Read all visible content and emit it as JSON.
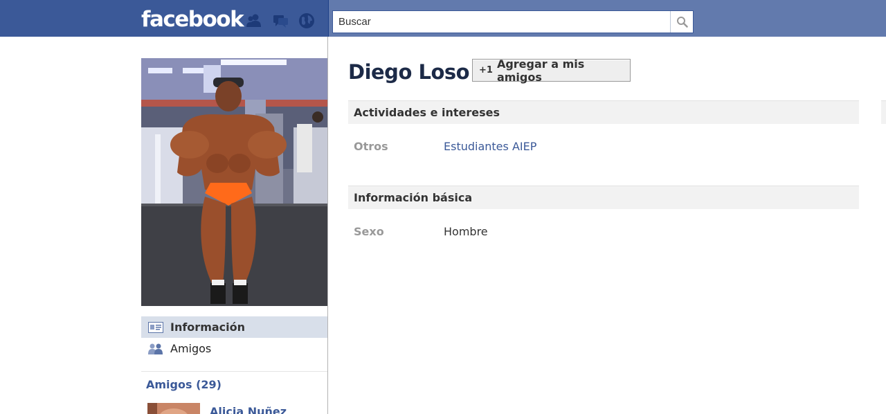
{
  "header": {
    "logo": "facebook",
    "search": {
      "placeholder": "Buscar"
    },
    "icons": [
      "friend-requests-icon",
      "messages-icon",
      "notifications-icon"
    ]
  },
  "sidebar": {
    "nav": [
      {
        "label": "Información",
        "icon": "info-card-icon",
        "selected": true
      },
      {
        "label": "Amigos",
        "icon": "friends-icon",
        "selected": false
      }
    ],
    "friends_heading": "Amigos (29)",
    "friends": [
      {
        "name": "Alicia Nuñez"
      }
    ]
  },
  "profile": {
    "name": "Diego Loso",
    "add_friend": {
      "icon": "+1",
      "label": "Agregar a mis amigos"
    },
    "sections": [
      {
        "title": "Actividades e intereses",
        "rows": [
          {
            "label": "Otros",
            "value": "Estudiantes AIEP"
          }
        ]
      },
      {
        "title": "Información básica",
        "rows": [
          {
            "label": "Sexo",
            "value": "Hombre"
          }
        ]
      }
    ]
  },
  "colors": {
    "brand_blue": "#3b5998",
    "header_light": "#627aad",
    "name_dark": "#1c2a47",
    "section_bg": "#f2f2f2",
    "label_gray": "#999999",
    "selected_nav_bg": "#d8dfea"
  }
}
